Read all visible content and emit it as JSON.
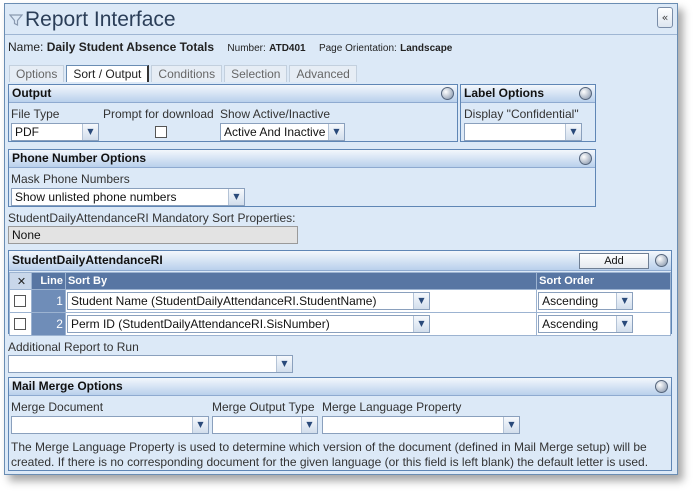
{
  "window": {
    "title": "Report Interface",
    "collapse_glyph": "«"
  },
  "report": {
    "name_label": "Name:",
    "name": "Daily Student Absence Totals",
    "number_label": "Number:",
    "number": "ATD401",
    "orientation_label": "Page Orientation:",
    "orientation": "Landscape"
  },
  "tabs": [
    {
      "label": "Options"
    },
    {
      "label": "Sort / Output",
      "active": true
    },
    {
      "label": "Conditions"
    },
    {
      "label": "Selection"
    },
    {
      "label": "Advanced"
    }
  ],
  "output": {
    "title": "Output",
    "file_type_label": "File Type",
    "file_type_value": "PDF",
    "prompt_label": "Prompt for download",
    "show_label": "Show Active/Inactive",
    "show_value": "Active And Inactive"
  },
  "label_options": {
    "title": "Label Options",
    "display_label": "Display \"Confidential\"",
    "display_value": ""
  },
  "phone": {
    "title": "Phone Number Options",
    "mask_label": "Mask Phone Numbers",
    "mask_value": "Show unlisted phone numbers"
  },
  "mandatory": {
    "label": "StudentDailyAttendanceRI Mandatory Sort Properties:",
    "value": "None"
  },
  "sort_grid": {
    "title": "StudentDailyAttendanceRI",
    "add_label": "Add",
    "delete_glyph": "✕",
    "headers": {
      "line": "Line",
      "sort_by": "Sort By",
      "sort_order": "Sort Order"
    },
    "rows": [
      {
        "line": "1",
        "sort_by": "Student Name (StudentDailyAttendanceRI.StudentName)",
        "order": "Ascending"
      },
      {
        "line": "2",
        "sort_by": "Perm ID (StudentDailyAttendanceRI.SisNumber)",
        "order": "Ascending"
      }
    ]
  },
  "additional": {
    "label": "Additional Report to Run",
    "value": ""
  },
  "mail_merge": {
    "title": "Mail Merge Options",
    "doc_label": "Merge Document",
    "doc_value": "",
    "type_label": "Merge Output Type",
    "type_value": "",
    "lang_label": "Merge Language Property",
    "lang_value": "",
    "note": "The Merge Language Property is used to determine which version of the document (defined in Mail Merge setup) will be created. If there is no corresponding document for the given language (or this field is left blank) the default letter is used."
  },
  "icons": {
    "dropdown_arrow": "▼"
  }
}
